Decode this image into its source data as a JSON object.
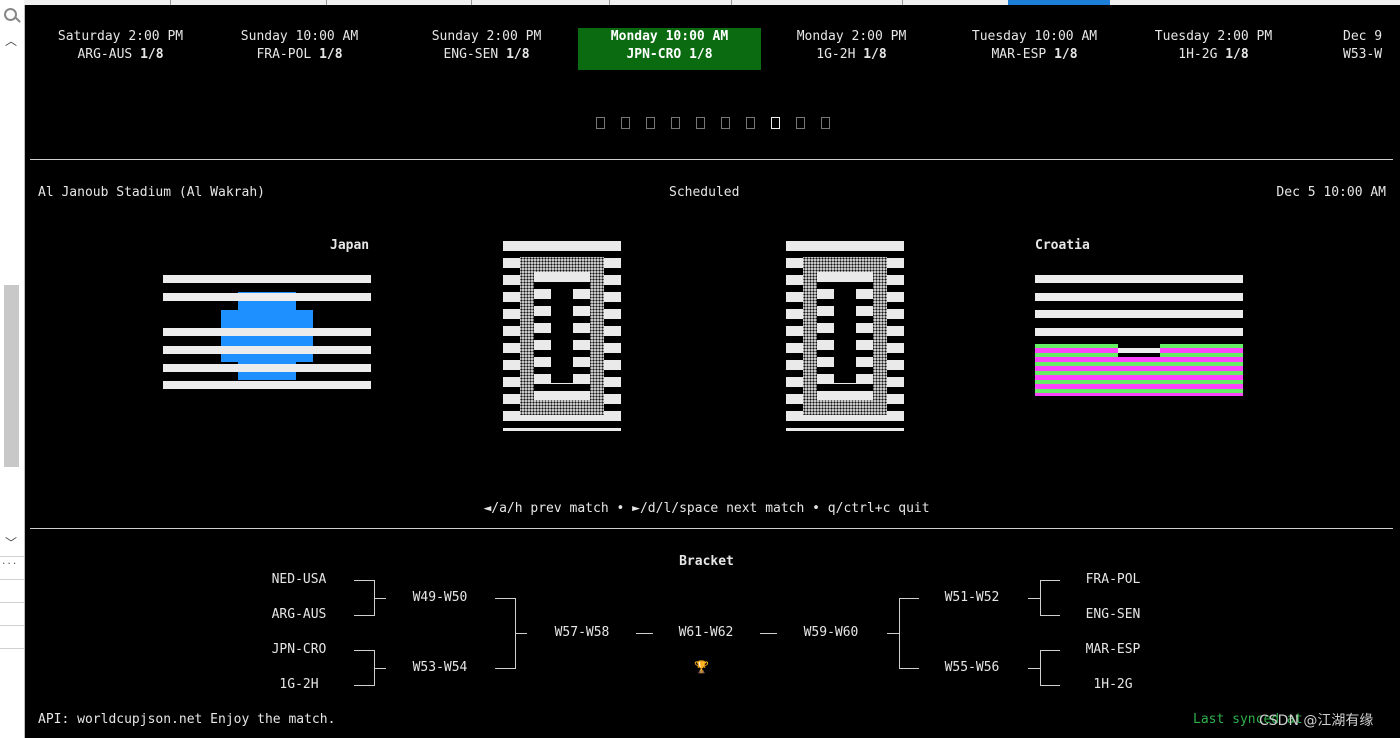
{
  "matches": [
    {
      "time": "Saturday 2:00 PM",
      "teams": "ARG-AUS",
      "round": "1/8"
    },
    {
      "time": "Sunday 10:00 AM",
      "teams": "FRA-POL",
      "round": "1/8"
    },
    {
      "time": "Sunday 2:00 PM",
      "teams": "ENG-SEN",
      "round": "1/8"
    },
    {
      "time": "Monday 10:00 AM",
      "teams": "JPN-CRO",
      "round": "1/8"
    },
    {
      "time": "Monday 2:00 PM",
      "teams": "1G-2H",
      "round": "1/8"
    },
    {
      "time": "Tuesday 10:00 AM",
      "teams": "MAR-ESP",
      "round": "1/8"
    },
    {
      "time": "Tuesday 2:00 PM",
      "teams": "1H-2G",
      "round": "1/8"
    },
    {
      "time": "Dec 9",
      "teams": "W53-W",
      "round": ""
    }
  ],
  "active_match_index": 3,
  "pager": {
    "count": 10,
    "active": 7
  },
  "match": {
    "venue": "Al Janoub Stadium (Al Wakrah)",
    "status": "Scheduled",
    "kickoff": "Dec 5 10:00 AM",
    "home_team": "Japan",
    "away_team": "Croatia",
    "home_score": "0",
    "away_score": "0"
  },
  "colors": {
    "active_tab": "#0a6b10",
    "japan_dot": "#1e90ff",
    "croatia_pink": "#ff44ff",
    "croatia_green": "#66ee66",
    "sync": "#2fb04a"
  },
  "help": "◄/a/h prev match • ►/d/l/space next match • q/ctrl+c quit",
  "bracket": {
    "title": "Bracket",
    "r16_left": [
      "NED-USA",
      "ARG-AUS",
      "JPN-CRO",
      "1G-2H"
    ],
    "qf_left": [
      "W49-W50",
      "W53-W54"
    ],
    "sf_left": "W57-W58",
    "final": "W61-W62",
    "sf_right": "W59-W60",
    "qf_right": [
      "W51-W52",
      "W55-W56"
    ],
    "r16_right": [
      "FRA-POL",
      "ENG-SEN",
      "MAR-ESP",
      "1H-2G"
    ],
    "dash": "—",
    "trophy": "🏆"
  },
  "footer": {
    "api": "API: worldcupjson.net  Enjoy the match.",
    "sync": "Last synced at"
  },
  "watermark": "CSDN @江湖有缘",
  "host": {
    "rows": [
      "...",
      "",
      "",
      "",
      ""
    ]
  }
}
